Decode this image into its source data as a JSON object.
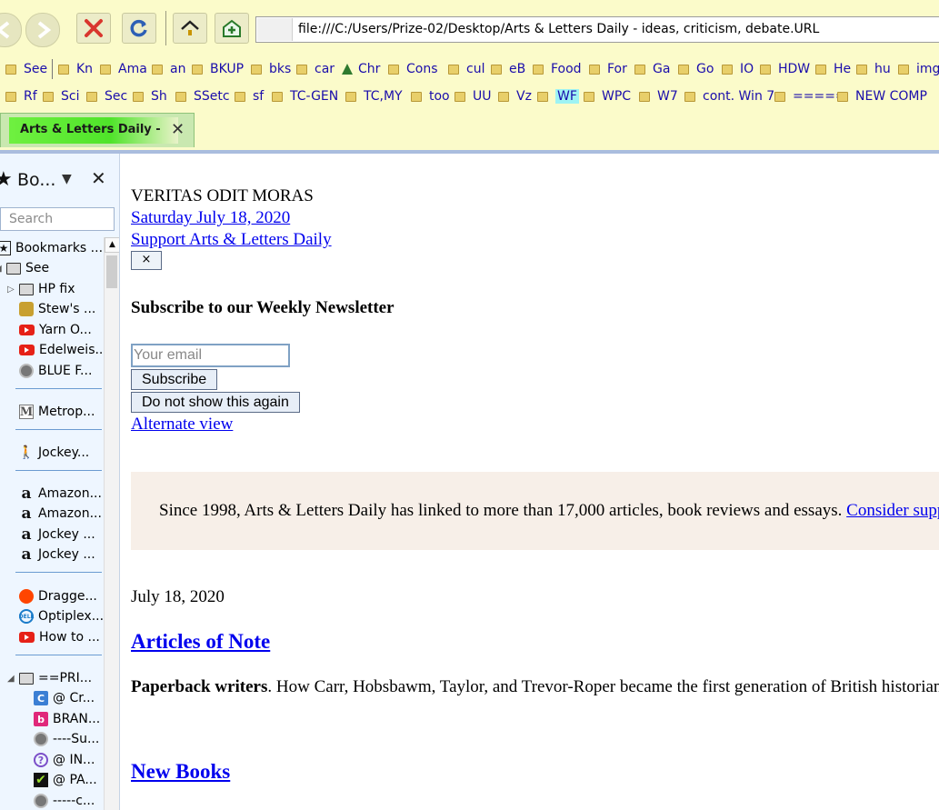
{
  "toolbar": {
    "url": "file:///C:/Users/Prize-02/Desktop/Arts & Letters Daily - ideas, criticism, debate.URL"
  },
  "bookmarks_row1": [
    "See",
    "Kn",
    "Ama",
    "an",
    "BKUP",
    "bks",
    "car",
    "Chr",
    "Cons",
    "cul",
    "eB",
    "Food",
    "For",
    "Ga",
    "Go",
    "IO",
    "HDW",
    "He",
    "hu",
    "img"
  ],
  "bookmarks_row2": [
    "Rf",
    "Sci",
    "Sec",
    "Sh",
    "SSetc",
    "sf",
    "TC-GEN",
    "TC,MY",
    "too",
    "UU",
    "Vz",
    "WF",
    "WPC",
    "W7",
    "cont. Win 7",
    "=====",
    "NEW COMP"
  ],
  "tab": {
    "title": "Arts & Letters Daily - ideas, criticism, debate"
  },
  "sidebar": {
    "title": "Bo...",
    "search_placeholder": "Search",
    "items": [
      "Bookmarks ...",
      "See",
      "HP fix",
      "Stew's ...",
      "Yarn O...",
      "Edelweis...",
      "BLUE F...",
      "Metrop...",
      "Jockey...",
      "Amazon...",
      "Amazon...",
      "Jockey ...",
      "Jockey ...",
      "Dragge...",
      "Optiplex...",
      "How to ...",
      "==PRI...",
      "@ Cr...",
      "BRAN...",
      "----Su...",
      "@ IN...",
      "@ PA...",
      "-----c..."
    ]
  },
  "content": {
    "motto": "VERITAS ODIT MORAS",
    "date_link": "Saturday July 18, 2020",
    "support_link": "Support Arts & Letters Daily",
    "close_label": "×",
    "newsletter_heading": "Subscribe to our Weekly Newsletter",
    "email_placeholder": "Your email",
    "subscribe_label": "Subscribe",
    "dont_show_label": "Do not show this again",
    "alternate_view": "Alternate view",
    "intro_text": "Since 1998, Arts & Letters Daily has linked to more than 17,000 articles, book reviews and essays.",
    "intro_link": "Consider supporting us",
    "date": "July 18, 2020",
    "section_articles": "Articles of Note",
    "article_title": "Paperback writers",
    "article_text": ". How Carr, Hobsbawm, Taylor, and Trevor-Roper became the first generation of British historians to become public intellectuals",
    "section_books": "New Books"
  }
}
